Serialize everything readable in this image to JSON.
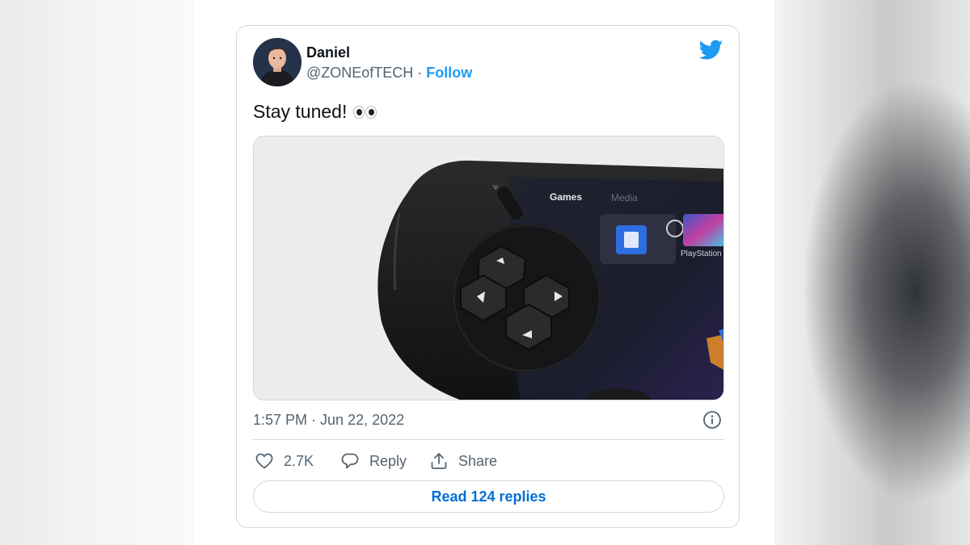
{
  "tweet": {
    "author_name": "Daniel",
    "handle": "@ZONEofTECH",
    "separator": " · ",
    "follow_label": "Follow",
    "text": "Stay tuned!",
    "emoji_icon": "eyes-emoji",
    "timestamp": "1:57 PM · Jun 22, 2022",
    "media": {
      "ui_tab_games": "Games",
      "ui_tab_media": "Media",
      "ui_tile_label": "PlayStation"
    },
    "actions": {
      "like_count": "2.7K",
      "reply_label": "Reply",
      "share_label": "Share"
    },
    "read_replies_label": "Read 124 replies"
  },
  "colors": {
    "accent": "#1d9bf0",
    "link": "#006fd6",
    "text_primary": "#0f1419",
    "text_secondary": "#536471",
    "border": "#cfd9de"
  },
  "icons": [
    "twitter-bird-icon",
    "info-icon",
    "heart-icon",
    "reply-bubble-icon",
    "share-icon"
  ]
}
